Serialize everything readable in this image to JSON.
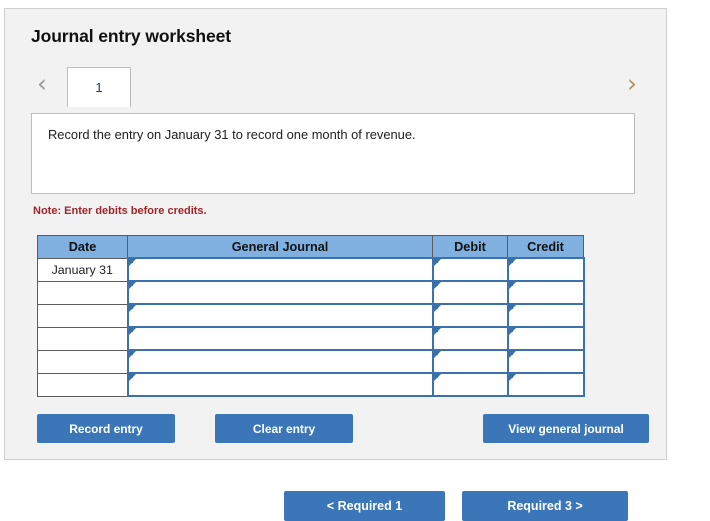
{
  "panel": {
    "title": "Journal entry worksheet"
  },
  "tabs": {
    "prev_icon": "chevron-left-icon",
    "next_icon": "chevron-right-icon",
    "items": [
      {
        "label": "1",
        "selected": true
      }
    ]
  },
  "prompt": {
    "text": "Record the entry on January 31 to record one month of revenue."
  },
  "note": {
    "text": "Note: Enter debits before credits."
  },
  "table": {
    "headers": [
      "Date",
      "General Journal",
      "Debit",
      "Credit"
    ],
    "rows": [
      {
        "date": "January 31",
        "general_journal": "",
        "debit": "",
        "credit": ""
      },
      {
        "date": "",
        "general_journal": "",
        "debit": "",
        "credit": ""
      },
      {
        "date": "",
        "general_journal": "",
        "debit": "",
        "credit": ""
      },
      {
        "date": "",
        "general_journal": "",
        "debit": "",
        "credit": ""
      },
      {
        "date": "",
        "general_journal": "",
        "debit": "",
        "credit": ""
      },
      {
        "date": "",
        "general_journal": "",
        "debit": "",
        "credit": ""
      }
    ]
  },
  "actions": {
    "record_entry": "Record entry",
    "clear_entry": "Clear entry",
    "view_general_journal": "View general journal"
  },
  "bottom_nav": {
    "prev": "< Required 1",
    "next": "Required 3 >"
  },
  "colors": {
    "accent_blue": "#3b76b8",
    "header_blue": "#7fb0e0",
    "cell_border_blue": "#3b72ad",
    "note_red": "#a0252b",
    "panel_bg": "#f2f2f2"
  }
}
